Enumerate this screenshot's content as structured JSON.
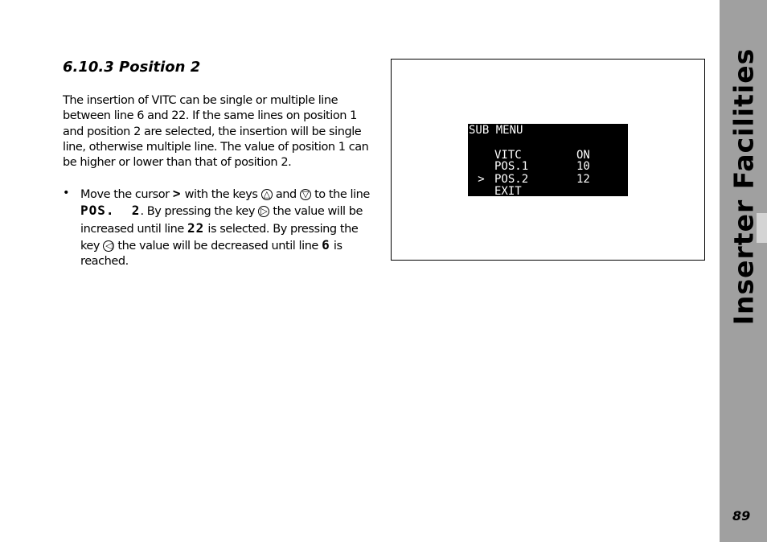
{
  "section": {
    "title": "6.10.3  Position 2"
  },
  "body": {
    "paragraph": "The insertion of VITC can be single or multiple line between line 6 and 22. If the same lines on position 1 and position 2 are selected, the insertion will be single line, otherwise multiple line. The value of position 1 can be higher or lower than that of position 2.",
    "bullet": {
      "t1": "Move the cursor ",
      "cursor": ">",
      "t2": " with the keys ",
      "key_up": "△",
      "t3": " and ",
      "key_down": "▽",
      "t4": " to the line ",
      "line_name": "POS.  2",
      "t5": ". By pressing the key ",
      "key_right": "▷",
      "t6": " the value will be increased until line ",
      "max": "22",
      "t7": " is selected. By pressing the key ",
      "key_left": "◁",
      "t8": " the value will be decreased until line ",
      "min": "6",
      "t9": " is reached."
    }
  },
  "display": {
    "title": "SUB MENU",
    "rows": [
      {
        "cursor": " ",
        "label": "VITC",
        "value": "ON"
      },
      {
        "cursor": " ",
        "label": "POS.1",
        "value": "10"
      },
      {
        "cursor": ">",
        "label": "POS.2",
        "value": "12"
      },
      {
        "cursor": " ",
        "label": "EXIT",
        "value": ""
      }
    ]
  },
  "sidebar": {
    "chapter": "Inserter Facilities",
    "page_number": "89"
  }
}
